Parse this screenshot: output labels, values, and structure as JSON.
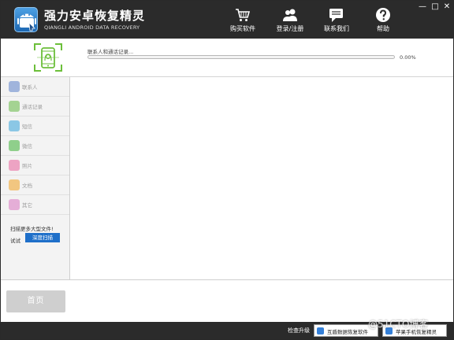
{
  "app": {
    "title": "强力安卓恢复精灵",
    "subtitle": "QIANGLI ANDROID DATA RECOVERY"
  },
  "nav": [
    {
      "label": "购买软件",
      "icon": "cart-icon"
    },
    {
      "label": "登录/注册",
      "icon": "users-icon"
    },
    {
      "label": "联系我们",
      "icon": "chat-icon"
    },
    {
      "label": "帮助",
      "icon": "help-icon"
    }
  ],
  "window_controls": {
    "minimize": "—",
    "maximize": "□",
    "close": "✕"
  },
  "scan": {
    "status": "联系人和通话记录...",
    "progress_percent": 0,
    "progress_text": "0.00%"
  },
  "sidebar": {
    "items": [
      {
        "label": "联系人",
        "icon": "contacts-icon",
        "color": "#5b7fc9"
      },
      {
        "label": "通话记录",
        "icon": "phone-icon",
        "color": "#62b842"
      },
      {
        "label": "短信",
        "icon": "sms-icon",
        "color": "#34a3d9"
      },
      {
        "label": "微信",
        "icon": "wechat-icon",
        "color": "#3cb034"
      },
      {
        "label": "照片",
        "icon": "photo-icon",
        "color": "#e8609a"
      },
      {
        "label": "文档",
        "icon": "document-icon",
        "color": "#f0a020"
      },
      {
        "label": "其它",
        "icon": "other-icon",
        "color": "#d874c0"
      }
    ],
    "deep_scan_hint": "扫描更多大型文件!",
    "try_label": "试试",
    "deep_scan_button": "深度扫描"
  },
  "home_button": "首页",
  "footer": {
    "upgrade_label": "检查升级",
    "links": [
      {
        "label": "互盾数据恢复软件"
      },
      {
        "label": "苹果手机恢复精灵"
      }
    ],
    "watermark": "@51CTO博客"
  },
  "colors": {
    "titlebar": "#2b2b2b",
    "accent": "#1e6fc9",
    "sidebar_bg": "#f3f3f3",
    "scan_frame": "#6cbf3a"
  }
}
